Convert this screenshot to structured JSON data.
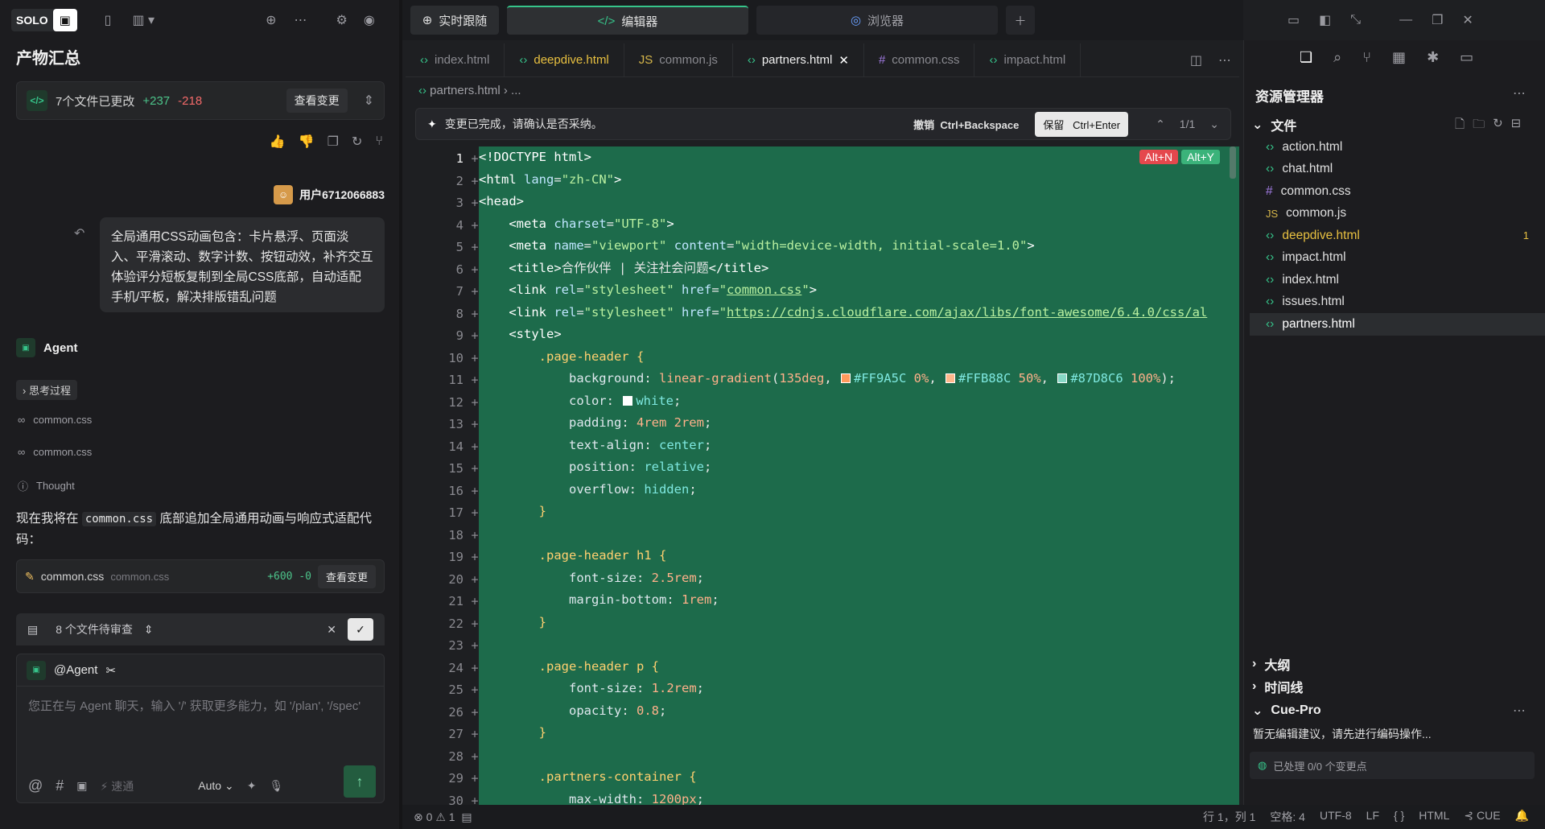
{
  "left": {
    "solo": "SOLO",
    "title": "产物汇总",
    "changes": {
      "text": "7个文件已更改",
      "plus": "+237",
      "minus": "-218",
      "view": "查看变更"
    },
    "user": "用户6712066883",
    "message": "全局通用CSS动画包含：卡片悬浮、页面淡入、平滑滚动、数字计数、按钮动效，补齐交互体验评分短板复制到全局CSS底部，自动适配手机/平板，解决排版错乱问题",
    "agent": "Agent",
    "thinking": "思考过程",
    "steps": [
      "common.css",
      "common.css",
      "Thought"
    ],
    "para_before": "现在我将在",
    "para_code": "common.css",
    "para_after": "底部追加全局通用动画与响应式适配代码：",
    "filecard": {
      "name": "common.css",
      "path": "common.css",
      "stat": "+600 -0",
      "view": "查看变更"
    },
    "pending": "8 个文件待审查",
    "chat": {
      "mention": "@Agent",
      "placeholder": "您正在与 Agent 聊天，输入 '/' 获取更多能力，如 '/plan', '/spec'",
      "speed": "速通",
      "mode": "Auto"
    }
  },
  "topbar": {
    "tab_tracking": "实时跟随",
    "tab_editor": "编辑器",
    "tab_browser": "浏览器"
  },
  "tabs": [
    {
      "label": "index.html",
      "icon": "<>"
    },
    {
      "label": "deepdive.html",
      "icon": "<>"
    },
    {
      "label": "common.js",
      "icon": "JS"
    },
    {
      "label": "partners.html",
      "icon": "<>"
    },
    {
      "label": "common.css",
      "icon": "#"
    },
    {
      "label": "impact.html",
      "icon": "<>"
    }
  ],
  "breadcrumb": "partners.html  ›  ...",
  "review": {
    "msg": "变更已完成，请确认是否采纳。",
    "undo": "撤销",
    "undo_key": "Ctrl+Backspace",
    "keep": "保留",
    "keep_key": "Ctrl+Enter",
    "count": "1/1",
    "alt_n": "Alt+N",
    "alt_y": "Alt+Y"
  },
  "code_lines": [
    "1",
    "2",
    "3",
    "4",
    "5",
    "6",
    "7",
    "8",
    "9",
    "10",
    "11",
    "12",
    "13",
    "14",
    "15",
    "16",
    "17",
    "18",
    "19",
    "20",
    "21",
    "22",
    "23",
    "24",
    "25",
    "26",
    "27",
    "28",
    "29",
    "30"
  ],
  "code": {
    "l1": "<!DOCTYPE html>",
    "l7href": "common.css",
    "l8href": "https://cdnjs.cloudflare.com/ajax/libs/font-awesome/6.4.0/css/al",
    "title": "合作伙伴 | 关注社会问题",
    "c1": "#FF9A5C",
    "c2": "#FFB88C",
    "c3": "#87D8C6"
  },
  "explorer": {
    "title": "资源管理器",
    "folder": "文件",
    "files": [
      {
        "name": "action.html",
        "icon": "<>"
      },
      {
        "name": "chat.html",
        "icon": "<>"
      },
      {
        "name": "common.css",
        "icon": "#"
      },
      {
        "name": "common.js",
        "icon": "JS"
      },
      {
        "name": "deepdive.html",
        "icon": "<>",
        "badge": "1"
      },
      {
        "name": "impact.html",
        "icon": "<>"
      },
      {
        "name": "index.html",
        "icon": "<>"
      },
      {
        "name": "issues.html",
        "icon": "<>"
      },
      {
        "name": "partners.html",
        "icon": "<>"
      }
    ],
    "outline": "大纲",
    "timeline": "时间线",
    "cue": "Cue-Pro",
    "cue_msg": "暂无编辑建议，请先进行编码操作...",
    "cue_status": "已处理 0/0 个变更点"
  },
  "status": {
    "errors": "0",
    "warnings": "1",
    "position": "行 1，列 1",
    "spaces": "空格: 4",
    "enc": "UTF-8",
    "eol": "LF",
    "braces": "{ }",
    "lang": "HTML",
    "cue": "CUE"
  },
  "colors": {
    "diff_bg": "#1d6b4b",
    "accent": "#36c48a"
  }
}
